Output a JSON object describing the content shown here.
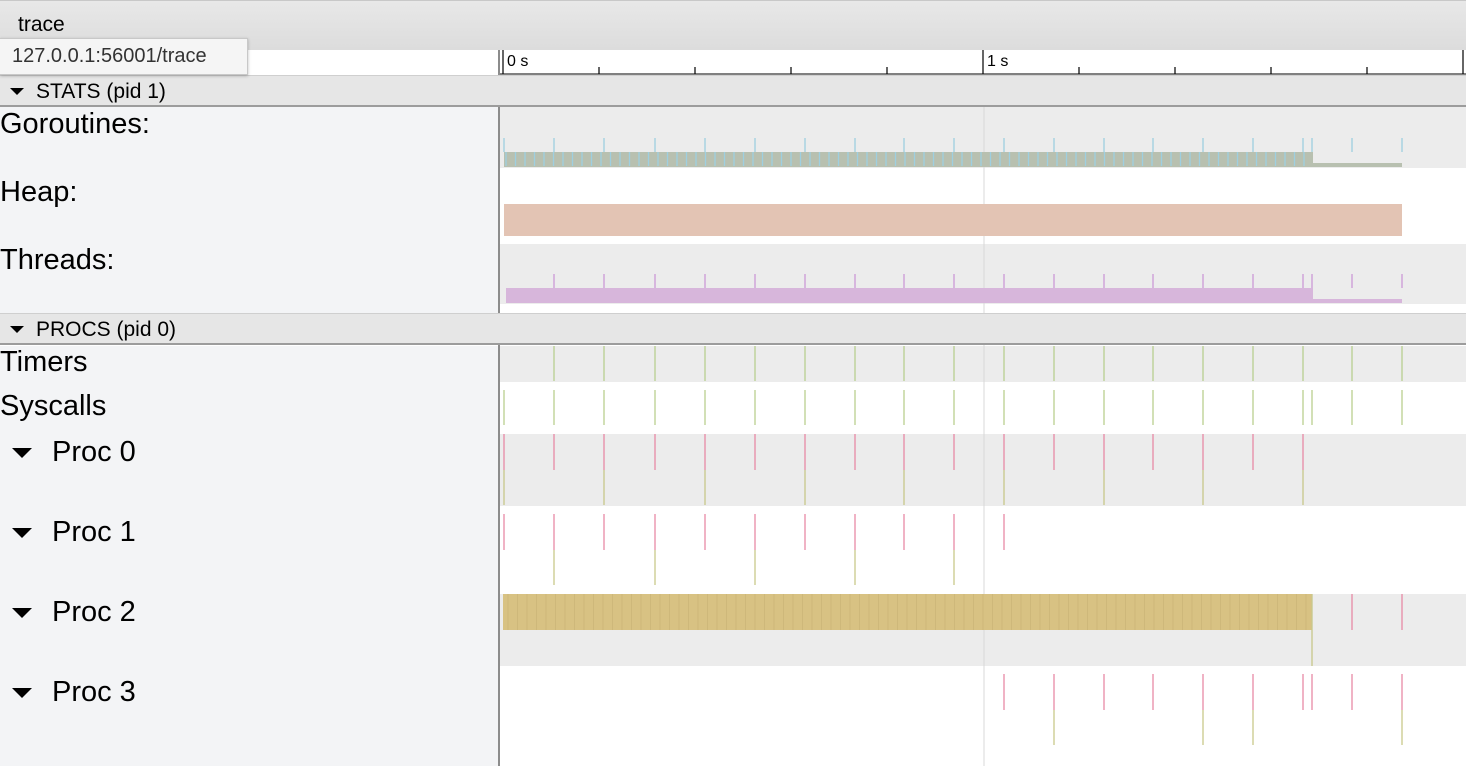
{
  "window": {
    "title": "trace",
    "url_tooltip": "127.0.0.1:56001/trace"
  },
  "ruler": {
    "tick_labels": [
      "0 s",
      "1 s"
    ]
  },
  "sections": {
    "stats": {
      "header": "STATS (pid 1)",
      "tracks": [
        {
          "label": "Goroutines:",
          "color": "#b8c0b0",
          "marker_color": "#9ecfe0"
        },
        {
          "label": "Heap:",
          "color": "#e3c4b4"
        },
        {
          "label": "Threads:",
          "color": "#d7b6db"
        }
      ]
    },
    "procs": {
      "header": "PROCS (pid 0)",
      "tracks": [
        {
          "label": "Timers"
        },
        {
          "label": "Syscalls"
        },
        {
          "label": "Proc 0"
        },
        {
          "label": "Proc 1"
        },
        {
          "label": "Proc 2",
          "color": "#d8c283"
        },
        {
          "label": "Proc 3"
        }
      ]
    }
  },
  "colors": {
    "event_pink": "#e88aa6",
    "event_olive": "#c8c88a",
    "event_green": "#b9cf8f",
    "purple": "#cc9ad8",
    "grid": "#d8d8d8"
  }
}
